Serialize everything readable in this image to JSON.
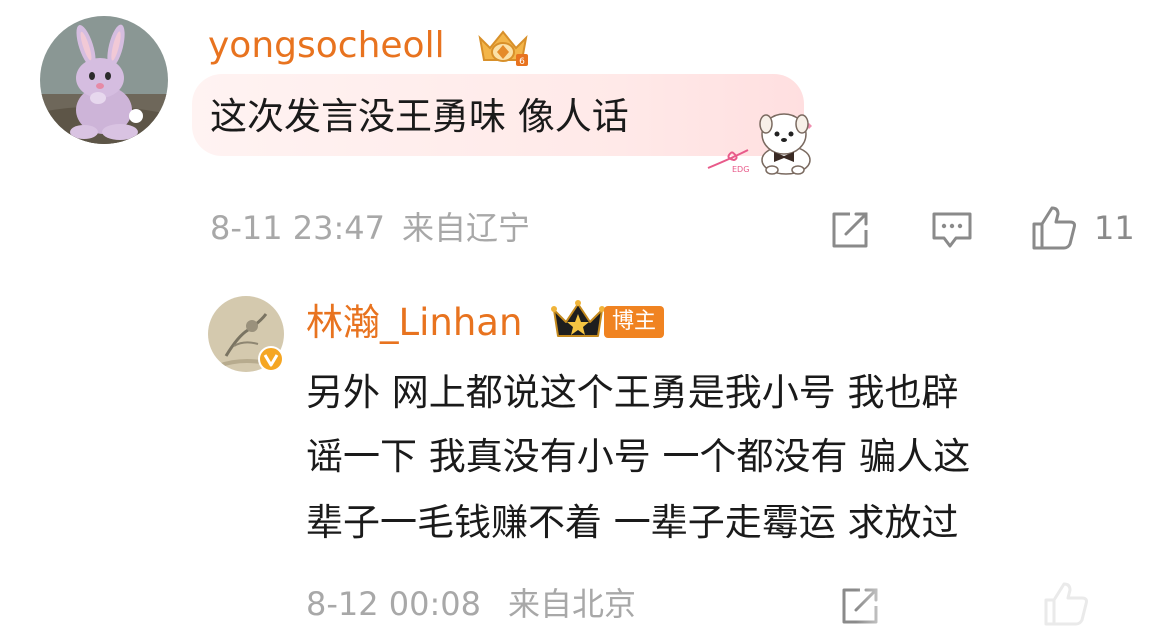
{
  "comment1": {
    "username": "yongsocheoll",
    "text": "这次发言没王勇味 像人话",
    "timestamp": "8-11 23:47",
    "location": "来自辽宁",
    "like_count": "11",
    "avatar": "bunny-avatar",
    "badge_icon": "crown-gem-badge-icon",
    "decoration": "puppy-sticker",
    "decoration_text": "EDG"
  },
  "reply1": {
    "username": "林瀚_Linhan",
    "badge_label": "博主",
    "text_lines": [
      "另外 网上都说这个王勇是我小号 我也辟",
      "谣一下 我真没有小号 一个都没有 骗人这",
      "辈子一毛钱赚不着 一辈子走霉运 求放过"
    ],
    "timestamp": "8-12 00:08",
    "location": "来自北京",
    "avatar": "sketch-avatar",
    "verified_icon": "verified-v-icon",
    "crown_icon": "crown-icon"
  },
  "colors": {
    "username": "#e8731f",
    "text": "#1a1a1a",
    "meta": "#a8a8a8",
    "badge_bg": "#f08321",
    "bubble": "#ffecec"
  }
}
